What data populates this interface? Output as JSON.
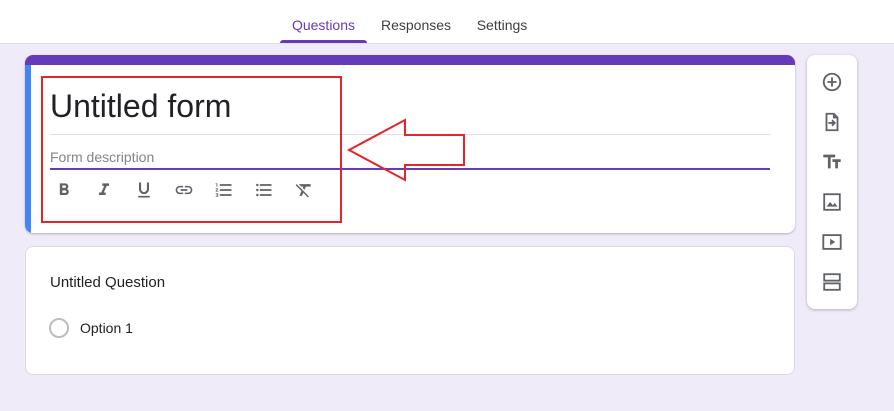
{
  "tabs": [
    {
      "label": "Questions",
      "active": true
    },
    {
      "label": "Responses",
      "active": false
    },
    {
      "label": "Settings",
      "active": false
    }
  ],
  "form": {
    "title": "Untitled form",
    "description_placeholder": "Form description"
  },
  "formatting_toolbar": [
    "bold-icon",
    "italic-icon",
    "underline-icon",
    "link-icon",
    "numbered-list-icon",
    "bulleted-list-icon",
    "clear-formatting-icon"
  ],
  "question": {
    "title": "Untitled Question",
    "options": [
      "Option 1"
    ]
  },
  "side_toolbar": [
    "add-question-icon",
    "import-questions-icon",
    "add-title-icon",
    "add-image-icon",
    "add-video-icon",
    "add-section-icon"
  ],
  "colors": {
    "accent": "#673ab7",
    "background": "#f0ebf8",
    "left_band": "#4285f4",
    "annotation": "#e3262c"
  }
}
